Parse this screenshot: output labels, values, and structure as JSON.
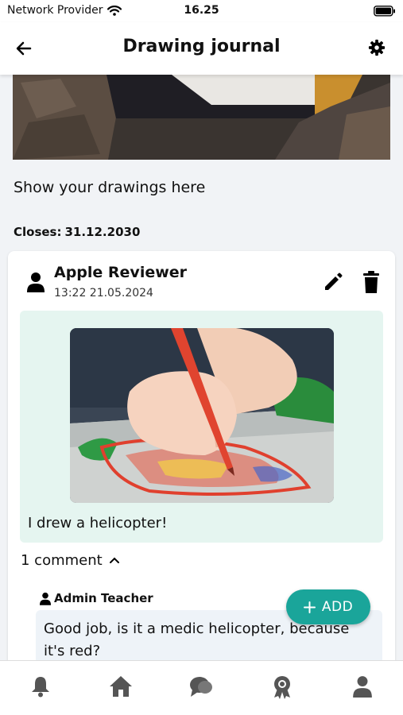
{
  "status_bar": {
    "carrier": "Network Provider",
    "time": "16.25"
  },
  "header": {
    "title": "Drawing journal",
    "back_icon": "arrow-left-icon",
    "settings_icon": "gear-icon"
  },
  "journal": {
    "description": "Show your drawings here",
    "closes_label": "Closes:",
    "closes_date": "31.12.2030"
  },
  "post": {
    "author": "Apple Reviewer",
    "timestamp": "13:22 21.05.2024",
    "text": "I drew a helicopter!",
    "comments_label": "1 comment",
    "comment": {
      "author": "Admin Teacher",
      "text": "Good job, is it a medic helicopter, because it's red?"
    }
  },
  "fab": {
    "label": "ADD"
  },
  "tabbar": {
    "items": [
      "bell-icon",
      "home-icon",
      "chat-icon",
      "award-icon",
      "user-icon"
    ]
  },
  "colors": {
    "accent": "#1aa59a",
    "post_bg": "#e5f5f0",
    "comment_bg": "#eef3f8"
  }
}
